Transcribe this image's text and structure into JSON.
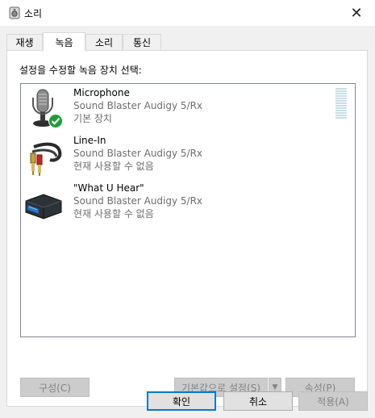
{
  "window": {
    "title": "소리",
    "close_glyph": "✕"
  },
  "tabs": [
    {
      "label": "재생",
      "active": false
    },
    {
      "label": "녹음",
      "active": true
    },
    {
      "label": "소리",
      "active": false
    },
    {
      "label": "통신",
      "active": false
    }
  ],
  "panel": {
    "instruction": "설정을 수정할 녹음 장치 선택:"
  },
  "devices": [
    {
      "name": "Microphone",
      "driver": "Sound Blaster Audigy 5/Rx",
      "status": "기본 장치",
      "icon": "microphone-icon",
      "is_default": true
    },
    {
      "name": "Line-In",
      "driver": "Sound Blaster Audigy 5/Rx",
      "status": "현재 사용할 수 없음",
      "icon": "rca-cable-icon",
      "is_default": false
    },
    {
      "name": "\"What U Hear\"",
      "driver": "Sound Blaster Audigy 5/Rx",
      "status": "현재 사용할 수 없음",
      "icon": "sound-card-icon",
      "is_default": false
    }
  ],
  "panel_buttons": {
    "configure": "구성(C)",
    "set_default": "기본값으로 설정(S)",
    "properties": "속성(P)"
  },
  "dialog_buttons": {
    "ok": "확인",
    "cancel": "취소",
    "apply": "적용(A)"
  },
  "colors": {
    "accent": "#0078d7",
    "check_green": "#1f9d3a",
    "meter": "#c6dee6"
  }
}
